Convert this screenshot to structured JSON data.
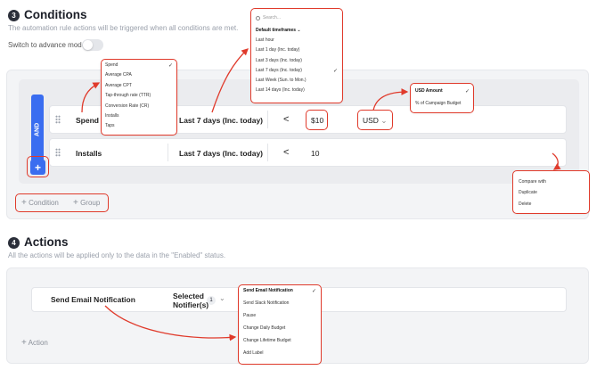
{
  "conditions": {
    "step": "3",
    "title": "Conditions",
    "subtitle": "The automation rule actions will be triggered when all conditions are met.",
    "toggle_label": "Switch to advance mode",
    "and_label": "AND",
    "rows": [
      {
        "metric": "Spend",
        "timeframe": "Last 7 days (Inc. today)",
        "operator": "<",
        "value": "$10",
        "currency": "USD"
      },
      {
        "metric": "Installs",
        "timeframe": "Last 7 days (Inc. today)",
        "operator": "<",
        "value": "10"
      }
    ],
    "add_condition": "Condition",
    "add_group": "Group"
  },
  "metric_dropdown": {
    "items": [
      "Spend",
      "Average CPA",
      "Average CPT",
      "Tap-through rate (TTR)",
      "Conversion Rate (CR)",
      "Installs",
      "Taps"
    ],
    "selected": "Spend"
  },
  "timeframe_dropdown": {
    "search_placeholder": "Search...",
    "group_label": "Default timeframes",
    "items": [
      "Last hour",
      "Last 1 day (Inc. today)",
      "Last 3 days (Inc. today)",
      "Last 7 days (Inc. today)",
      "Last Week (Sun. to Mon.)",
      "Last 14 days (Inc. today)"
    ],
    "selected": "Last 7 days (Inc. today)"
  },
  "currency_dropdown": {
    "items": [
      "USD Amount",
      "% of Campaign Budget"
    ],
    "selected": "USD Amount"
  },
  "row_menu": {
    "items": [
      "Compare with",
      "Duplicate",
      "Delete"
    ]
  },
  "actions": {
    "step": "4",
    "title": "Actions",
    "subtitle": "All the actions will be applied only to the data in the \"Enabled\" status.",
    "row_action": "Send Email Notification",
    "notifier_label": "Selected Notifier(s)",
    "notifier_count": "1",
    "add_action": "Action"
  },
  "action_dropdown": {
    "items": [
      "Send Email Notification",
      "Send Slack Notification",
      "Pause",
      "Change Daily Budget",
      "Change Lifetime Budget",
      "Add Label"
    ],
    "selected": "Send Email Notification"
  },
  "colors": {
    "accent": "#3a6df0",
    "highlight": "#e03a2b"
  }
}
